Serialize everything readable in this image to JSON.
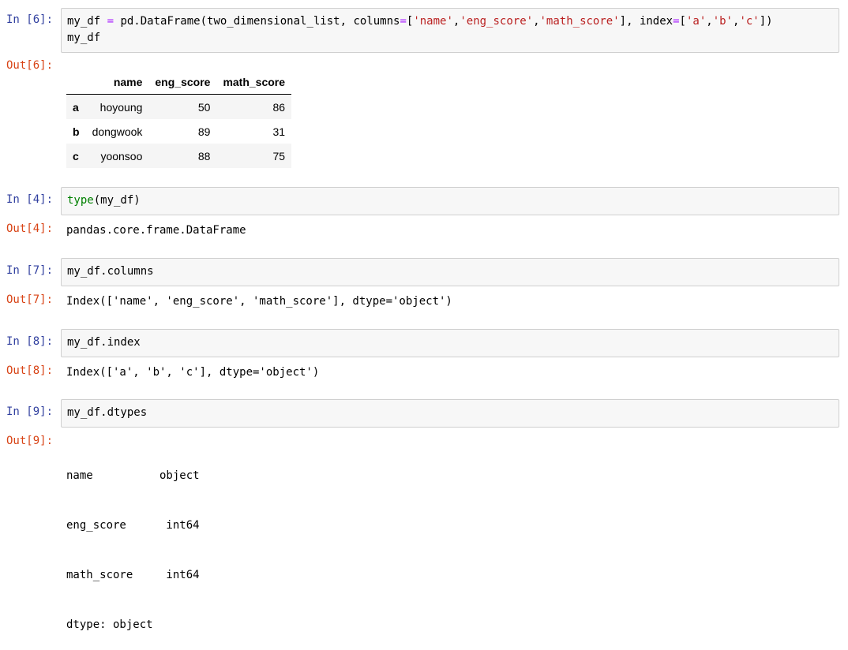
{
  "cells": [
    {
      "in_prompt": "In [6]:",
      "out_prompt": "Out[6]:",
      "code_line1": [
        {
          "t": "my_df ",
          "c": ""
        },
        {
          "t": "=",
          "c": "op"
        },
        {
          "t": " pd.DataFrame(two_dimensional_list, columns",
          "c": ""
        },
        {
          "t": "=",
          "c": "op"
        },
        {
          "t": "[",
          "c": ""
        },
        {
          "t": "'name'",
          "c": "s"
        },
        {
          "t": ",",
          "c": ""
        },
        {
          "t": "'eng_score'",
          "c": "s"
        },
        {
          "t": ",",
          "c": ""
        },
        {
          "t": "'math_score'",
          "c": "s"
        },
        {
          "t": "], index",
          "c": ""
        },
        {
          "t": "=",
          "c": "op"
        },
        {
          "t": "[",
          "c": ""
        },
        {
          "t": "'a'",
          "c": "s"
        },
        {
          "t": ",",
          "c": ""
        },
        {
          "t": "'b'",
          "c": "s"
        },
        {
          "t": ",",
          "c": ""
        },
        {
          "t": "'c'",
          "c": "s"
        },
        {
          "t": "])",
          "c": ""
        }
      ],
      "code_line2": "my_df",
      "table": {
        "columns": [
          "",
          "name",
          "eng_score",
          "math_score"
        ],
        "rows": [
          {
            "index": "a",
            "name": "hoyoung",
            "eng_score": "50",
            "math_score": "86"
          },
          {
            "index": "b",
            "name": "dongwook",
            "eng_score": "89",
            "math_score": "31"
          },
          {
            "index": "c",
            "name": "yoonsoo",
            "eng_score": "88",
            "math_score": "75"
          }
        ]
      }
    },
    {
      "in_prompt": "In [4]:",
      "out_prompt": "Out[4]:",
      "code_builtin": "type",
      "code_rest": "(my_df)",
      "output": "pandas.core.frame.DataFrame"
    },
    {
      "in_prompt": "In [7]:",
      "out_prompt": "Out[7]:",
      "code": "my_df.columns",
      "output": "Index(['name', 'eng_score', 'math_score'], dtype='object')"
    },
    {
      "in_prompt": "In [8]:",
      "out_prompt": "Out[8]:",
      "code": "my_df.index",
      "output": "Index(['a', 'b', 'c'], dtype='object')"
    },
    {
      "in_prompt": "In [9]:",
      "out_prompt": "Out[9]:",
      "code": "my_df.dtypes",
      "output_lines": [
        "name          object",
        "eng_score      int64",
        "math_score     int64",
        "dtype: object"
      ]
    }
  ]
}
